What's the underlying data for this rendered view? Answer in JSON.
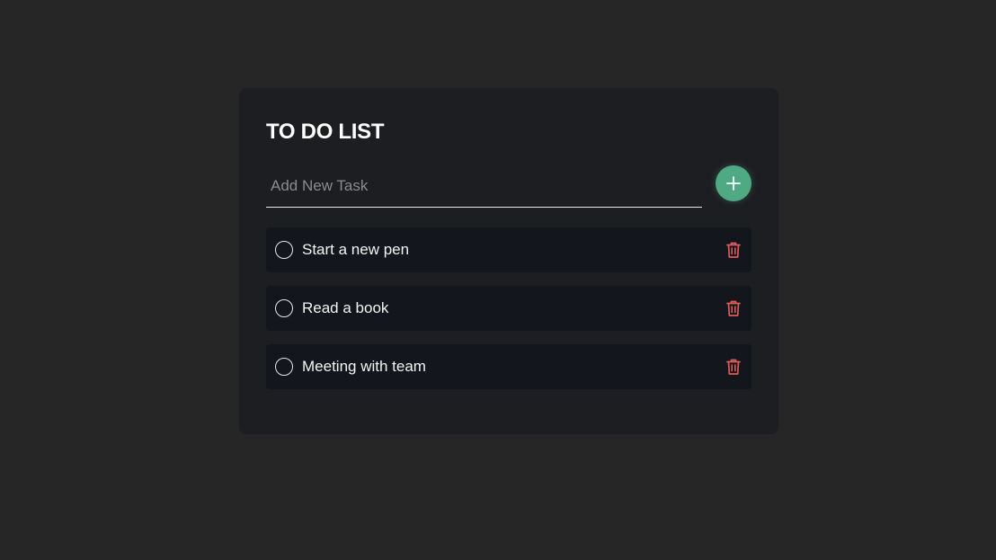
{
  "app": {
    "title": "TO DO LIST"
  },
  "input": {
    "placeholder": "Add New Task",
    "value": ""
  },
  "add_button": {
    "icon": "plus-icon"
  },
  "tasks": [
    {
      "label": "Start a new pen",
      "done": false
    },
    {
      "label": "Read a book",
      "done": false
    },
    {
      "label": "Meeting with team",
      "done": false
    }
  ],
  "colors": {
    "background": "#262626",
    "card": "#1d1e21",
    "task_row": "#13161d",
    "accent": "#4fa983",
    "delete": "#e05a5a"
  },
  "icons": {
    "delete": "trash-icon",
    "checkbox": "circle-checkbox-icon"
  }
}
